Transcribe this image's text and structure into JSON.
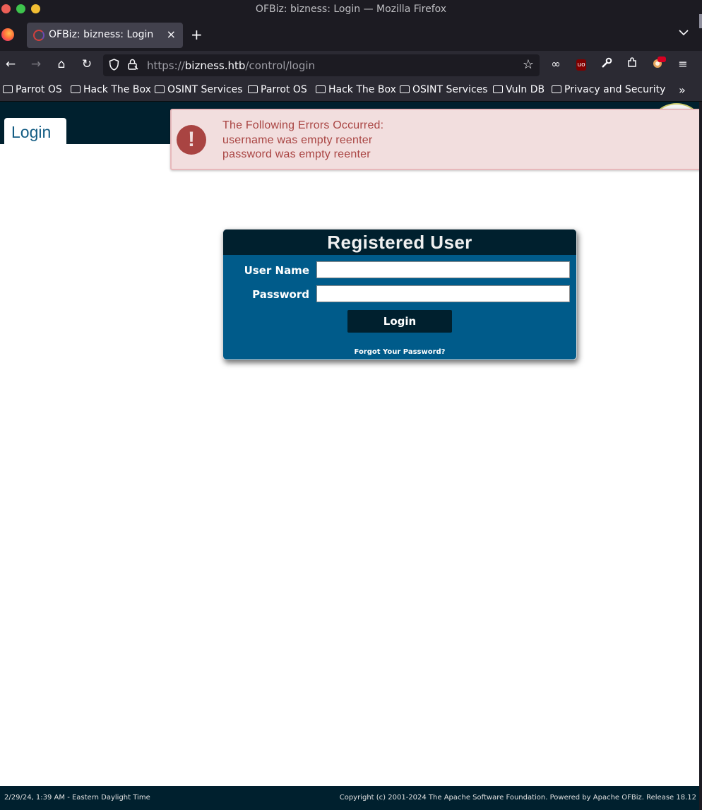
{
  "window": {
    "title": "OFBiz: bizness: Login — Mozilla Firefox"
  },
  "tabs": [
    {
      "title": "OFBiz: bizness: Login",
      "close": "×"
    }
  ],
  "toolbar": {
    "new_tab": "+",
    "tab_list": "⌄",
    "back": "←",
    "forward": "→",
    "home": "⌂",
    "reload": "↻"
  },
  "urlbar": {
    "scheme": "https://",
    "host": "bizness.htb",
    "path": "/control/login",
    "shield_icon": "shield-icon",
    "lock_icon": "lock-icon",
    "star": "☆"
  },
  "extensions": {
    "mask": "∞",
    "ublock": "uo",
    "wrench": "🔧",
    "puzzle": "⧉",
    "menu": "≡"
  },
  "bookmarks": [
    "Parrot OS",
    "Hack The Box",
    "OSINT Services",
    "Parrot OS",
    "Hack The Box",
    "OSINT Services",
    "Vuln DB",
    "Privacy and Security"
  ],
  "bookmarks_more": "»",
  "page": {
    "login_tab": "Login",
    "errors": {
      "icon": "!",
      "heading": "The Following Errors Occurred:",
      "messages": [
        "username was empty reenter",
        "password was empty reenter"
      ]
    },
    "login_box": {
      "title": "Registered User",
      "username_label": "User Name",
      "username_value": "",
      "password_label": "Password",
      "password_value": "",
      "login_button": "Login",
      "forgot_link": "Forgot Your Password?"
    },
    "footer": {
      "left": "2/29/24, 1:39 AM - Eastern Daylight Time",
      "right": "Copyright (c) 2001-2024 The Apache Software Foundation. Powered by Apache OFBiz. Release 18.12"
    }
  },
  "colors": {
    "header_band": "#00202e",
    "login_box": "#005b8a",
    "error_text": "#a94442",
    "error_bg": "#f2dede"
  }
}
